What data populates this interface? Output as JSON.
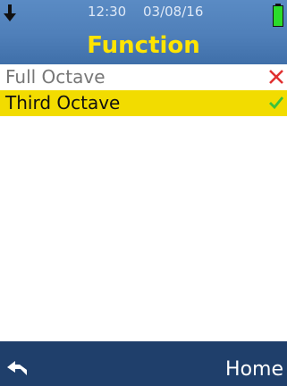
{
  "status": {
    "time": "12:30",
    "date": "03/08/16",
    "left_icon": "download-arrow-icon",
    "right_icon": "battery-full-icon"
  },
  "header": {
    "title": "Function"
  },
  "list": {
    "items": [
      {
        "label": "Full Octave",
        "state_icon": "cross-icon",
        "selected": false
      },
      {
        "label": "Third Octave",
        "state_icon": "check-icon",
        "selected": true
      }
    ]
  },
  "footer": {
    "back_icon": "back-arrow-icon",
    "home_label": "Home"
  },
  "colors": {
    "header_bg": "#4f7fb9",
    "title": "#ffe400",
    "selected_bg": "#f2dc00",
    "footer_bg": "#1f3f6b",
    "cross": "#e03030",
    "check": "#3cc23c",
    "battery": "#2bdc2b"
  }
}
